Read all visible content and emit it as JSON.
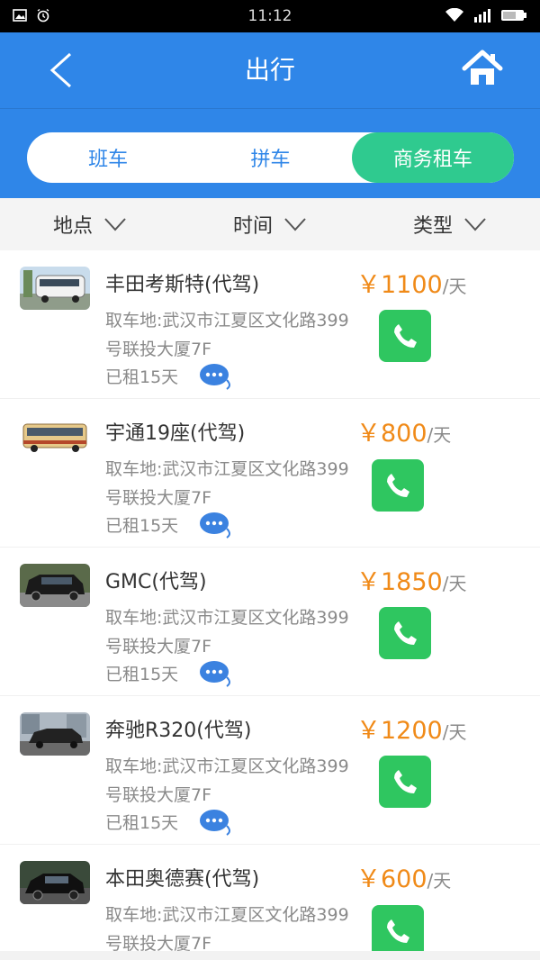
{
  "status_bar": {
    "time": "11:12"
  },
  "header": {
    "title": "出行"
  },
  "tabs": [
    {
      "label": "班车",
      "active": false
    },
    {
      "label": "拼车",
      "active": false
    },
    {
      "label": "商务租车",
      "active": true
    }
  ],
  "filters": [
    {
      "label": "地点"
    },
    {
      "label": "时间"
    },
    {
      "label": "类型"
    }
  ],
  "listings": [
    {
      "name": "丰田考斯特(代驾)",
      "address": "取车地:武汉市江夏区文化路399号联投大厦7F",
      "rented": "已租15天",
      "price": "￥1100",
      "unit": "/天",
      "image": "minibus"
    },
    {
      "name": "宇通19座(代驾)",
      "address": "取车地:武汉市江夏区文化路399号联投大厦7F",
      "rented": "已租15天",
      "price": "￥800",
      "unit": "/天",
      "image": "coach-bus"
    },
    {
      "name": "GMC(代驾)",
      "address": "取车地:武汉市江夏区文化路399号联投大厦7F",
      "rented": "已租15天",
      "price": "￥1850",
      "unit": "/天",
      "image": "suv"
    },
    {
      "name": "奔驰R320(代驾)",
      "address": "取车地:武汉市江夏区文化路399号联投大厦7F",
      "rented": "已租15天",
      "price": "￥1200",
      "unit": "/天",
      "image": "mpv"
    },
    {
      "name": "本田奥德赛(代驾)",
      "address": "取车地:武汉市江夏区文化路399号联投大厦7F",
      "rented": "",
      "price": "￥600",
      "unit": "/天",
      "image": "van"
    }
  ],
  "colors": {
    "primary": "#2f86e8",
    "active_tab": "#2fca8f",
    "price": "#f08a18",
    "call": "#2fc660"
  }
}
